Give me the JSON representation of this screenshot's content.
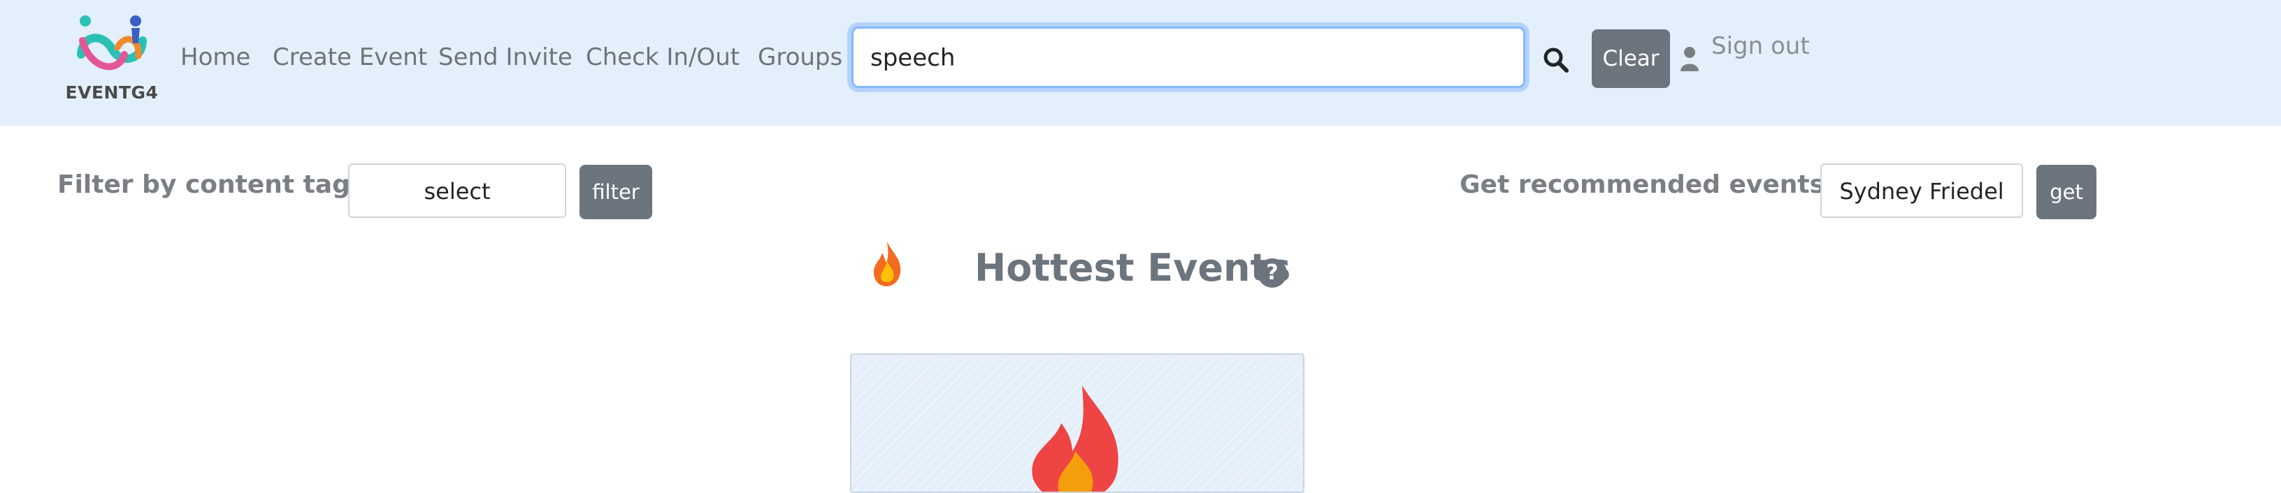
{
  "brand": {
    "name": "EVENTG4"
  },
  "nav": {
    "links": [
      "Home",
      "Create Event",
      "Send Invite",
      "Check In/Out",
      "Groups"
    ]
  },
  "search": {
    "value": "speech"
  },
  "header_actions": {
    "clear_label": "Clear",
    "signout_label": "Sign out"
  },
  "filter": {
    "label": "Filter by content tag:",
    "select_value": "select",
    "button_label": "filter"
  },
  "recommend": {
    "label": "Get recommended events:",
    "value": "Sydney Friedel",
    "button_label": "get"
  },
  "hottest": {
    "title": "Hottest Events",
    "help_glyph": "?"
  },
  "icons": [
    "logo-icon",
    "search-icon",
    "user-icon",
    "fire-icon",
    "help-icon"
  ],
  "colors": {
    "navbar_bg": "#e3f0fb",
    "button_grey": "#6c757d",
    "focus_ring": "#86b7fe",
    "fire_red": "#ef4444"
  }
}
